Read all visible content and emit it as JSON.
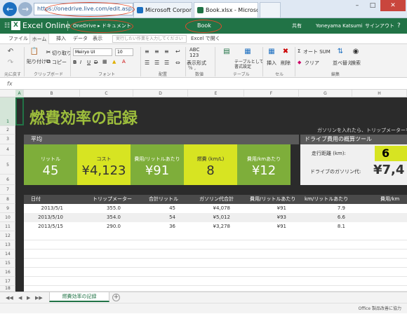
{
  "browser": {
    "address": "https://onedrive.live.com/edit.aspx?resid=...",
    "tabs": [
      {
        "label": "Microsoft Corpor...",
        "favicon_color": "#1c6fc0"
      },
      {
        "label": "Book.xlsx - Microsoft Ex...",
        "favicon_color": "#217346"
      },
      {
        "label": ""
      }
    ],
    "window_controls": [
      "–",
      "□",
      "✕"
    ]
  },
  "app": {
    "name": "Excel Online",
    "breadcrumb": "OneDrive ▸ ドキュメント",
    "document": "Book",
    "share": "共有",
    "user": "Yoneyama Katsumi",
    "signout": "サインアウト",
    "help": "?"
  },
  "ribbon_tabs": [
    "ファイル",
    "ホーム",
    "挿入",
    "データ",
    "表示"
  ],
  "tell_me_placeholder": "実行したい作業を入力してください",
  "open_in_excel": "Excel で開く",
  "ribbon": {
    "clipboard": {
      "paste": "貼り付け",
      "cut": "切り取り",
      "copy": "コピー",
      "group": "クリップボード"
    },
    "undo": {
      "group": "元に戻す"
    },
    "font": {
      "name": "Meiryo UI",
      "size": "10",
      "group": "フォント"
    },
    "alignment": {
      "group": "配置"
    },
    "number": {
      "format": "表示形式",
      "group": "数値"
    },
    "table": {
      "table": "テーブルとして書式設定",
      "group": "テーブル"
    },
    "cells": {
      "insert": "挿入",
      "delete": "削除",
      "group": "セル"
    },
    "editing": {
      "autosum": "オート SUM",
      "clear": "クリア",
      "sort": "並べ替え",
      "find": "検索",
      "group": "編集"
    }
  },
  "formula_bar": {
    "fx": "fx"
  },
  "columns": [
    "A",
    "B",
    "C",
    "D",
    "E",
    "F",
    "G",
    "H"
  ],
  "rows": [
    "1",
    "2",
    "3",
    "4",
    "5",
    "6",
    "7",
    "8",
    "9",
    "10",
    "11",
    "12",
    "13",
    "14",
    "15",
    "16",
    "17",
    "18",
    "19",
    "20"
  ],
  "sheet": {
    "title": "燃費効率の記録",
    "hint": "ガソリンを入れたら、トリップメーターをリ",
    "average_label": "平均",
    "kpis": [
      {
        "label": "リットル",
        "value": "45",
        "style": "green"
      },
      {
        "label": "コスト",
        "value": "¥4,123",
        "style": "yellow"
      },
      {
        "label": "費用/リットルあたり",
        "value": "¥91",
        "style": "green"
      },
      {
        "label": "燃費 (km/L)",
        "value": "8",
        "style": "yellow"
      },
      {
        "label": "費用/kmあたり",
        "value": "¥12",
        "style": "green"
      }
    ],
    "tool": {
      "title": "ドライブ費用の概算ツール",
      "distance_label": "走行距離 (km):",
      "distance_value": "6",
      "cost_label": "ドライブのガソリン代:",
      "cost_value": "¥7,4"
    },
    "table": {
      "headers": [
        "日付",
        "トリップメーター",
        "合計リットル",
        "ガソリン代合計",
        "費用/リットルあたり",
        "km/リットルあたり",
        "費用/km"
      ],
      "rows": [
        [
          "2013/5/1",
          "355.0",
          "45",
          "¥4,078",
          "¥91",
          "7.9",
          ""
        ],
        [
          "2013/5/10",
          "354.0",
          "54",
          "¥5,012",
          "¥93",
          "6.6",
          ""
        ],
        [
          "2013/5/15",
          "290.0",
          "36",
          "¥3,278",
          "¥91",
          "8.1",
          ""
        ]
      ]
    }
  },
  "sheet_tab": "燃費効率の記録",
  "status": "Office 製品改善に協力"
}
